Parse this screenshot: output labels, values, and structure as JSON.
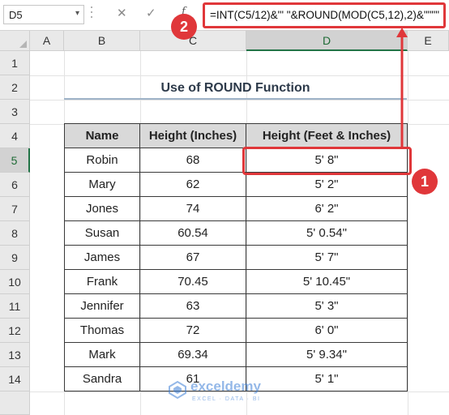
{
  "formula_bar": {
    "name_box": "D5",
    "fx_label": "f",
    "formula": "=INT(C5/12)&\"' \"&ROUND(MOD(C5,12),2)&\"\"\"\""
  },
  "columns": [
    "A",
    "B",
    "C",
    "D",
    "E"
  ],
  "rows": [
    "1",
    "2",
    "3",
    "4",
    "5",
    "6",
    "7",
    "8",
    "9",
    "10",
    "11",
    "12",
    "13",
    "14"
  ],
  "title": "Use of ROUND Function",
  "table": {
    "headers": [
      "Name",
      "Height (Inches)",
      "Height (Feet & Inches)"
    ],
    "rows": [
      [
        "Robin",
        "68",
        "5' 8\""
      ],
      [
        "Mary",
        "62",
        "5' 2\""
      ],
      [
        "Jones",
        "74",
        "6' 2\""
      ],
      [
        "Susan",
        "60.54",
        "5' 0.54\""
      ],
      [
        "James",
        "67",
        "5' 7\""
      ],
      [
        "Frank",
        "70.45",
        "5' 10.45\""
      ],
      [
        "Jennifer",
        "63",
        "5' 3\""
      ],
      [
        "Thomas",
        "72",
        "6' 0\""
      ],
      [
        "Mark",
        "69.34",
        "5' 9.34\""
      ],
      [
        "Sandra",
        "61",
        "5' 1\""
      ]
    ]
  },
  "annotations": {
    "badge_1": "1",
    "badge_2": "2"
  },
  "watermark": {
    "name": "exceldemy",
    "tagline": "EXCEL · DATA · BI"
  },
  "colors": {
    "accent_red": "#e0373a",
    "excel_green": "#217346",
    "header_fill": "#d9d9d9"
  }
}
